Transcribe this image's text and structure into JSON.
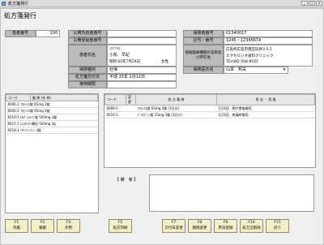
{
  "window": {
    "title": "処方箋発行"
  },
  "page": {
    "heading": "処方箋発行"
  },
  "patient": {
    "number_label": "患者番号",
    "number": "100",
    "name_label": "患者氏名",
    "kana": "ｺﾏﾂ ｻﾁｴ",
    "name": "小松　早紀",
    "birth": "昭和 62年7月24日",
    "sex": "女性",
    "insured_category_label": "保険種別",
    "insured_category": "社保",
    "rx_date_label": "処方箋交付日",
    "rx_date": "平成 25年 2月12日",
    "validity_label": "使用期限",
    "validity": ""
  },
  "public": {
    "payer_label": "公費負担者番号",
    "payer": "",
    "recipient_label": "公費受給者番号",
    "recipient": ""
  },
  "insurance": {
    "insurer_label": "保険者番号",
    "insurer": "01340017",
    "symbol_label": "記号・番号",
    "symbol": "1245・12345674",
    "facility_label": "保険医療機関の名称及び所在地",
    "facility_line1": "広島県広島市南区段原3-5-1",
    "facility_line2": "エクセルシオ歯科クリニック",
    "facility_line3": "TEL082-568-8161",
    "doctor_label": "保険医氏名",
    "doctor": "山本　邦夫"
  },
  "drug_list": {
    "col_code": "コード",
    "col_name": "薬 剤 (名 称)",
    "items": [
      {
        "code": "6000-1",
        "name": "ﾌﾛﾓｯｸｽ錠 65mg 3錠"
      },
      {
        "code": "6000-2",
        "name": "ﾌﾛﾓｯｸｽ錠 65mg 3錠"
      },
      {
        "code": "6010-1",
        "name": "ｶﾙﾎﾞｼｽﾃｲﾝ錠 500mg 3錠"
      },
      {
        "code": "6017-1",
        "name": "ﾑｺｽﾀﾝﾁﾝ顆粒 500mg 3g"
      },
      {
        "code": "6018-1",
        "name": "ｱｾﾄｱﾐﾉﾌｪﾝ 3錠"
      }
    ]
  },
  "rx_table": {
    "col_code": "コード",
    "col_change": "変更",
    "col_name": "処 方 薬 剤",
    "col_usage": "用 法 ・ 容 量",
    "rows": [
      {
        "code": "6000-2",
        "change": "",
        "name": "ﾌﾛﾓｯｸｽ錠 65mg 3錠 (3日分)",
        "usage": "1日3回　朝夕食後服用"
      },
      {
        "code": "6010-1",
        "change": "",
        "name": "ﾃﾞﾙﾓﾎﾞﾚﾝ錠 25mg 3錠 (3日分)",
        "usage": "1日3回　疼痛時服用"
      }
    ]
  },
  "notes": {
    "label": "【 備　考 】",
    "text": ""
  },
  "fkeys": [
    {
      "key": "F1",
      "label": "内服"
    },
    {
      "key": "F2",
      "label": "頓服"
    },
    {
      "key": "F3",
      "label": "外用"
    },
    {
      "key": "F5",
      "label": "処方印刷"
    },
    {
      "key": "F7",
      "label": "交付日変更"
    },
    {
      "key": "F8",
      "label": "期限変更"
    },
    {
      "key": "F9",
      "label": "用法登録"
    },
    {
      "key": "F10",
      "label": "処方全削除"
    },
    {
      "key": "F11",
      "label": "戻り"
    }
  ]
}
